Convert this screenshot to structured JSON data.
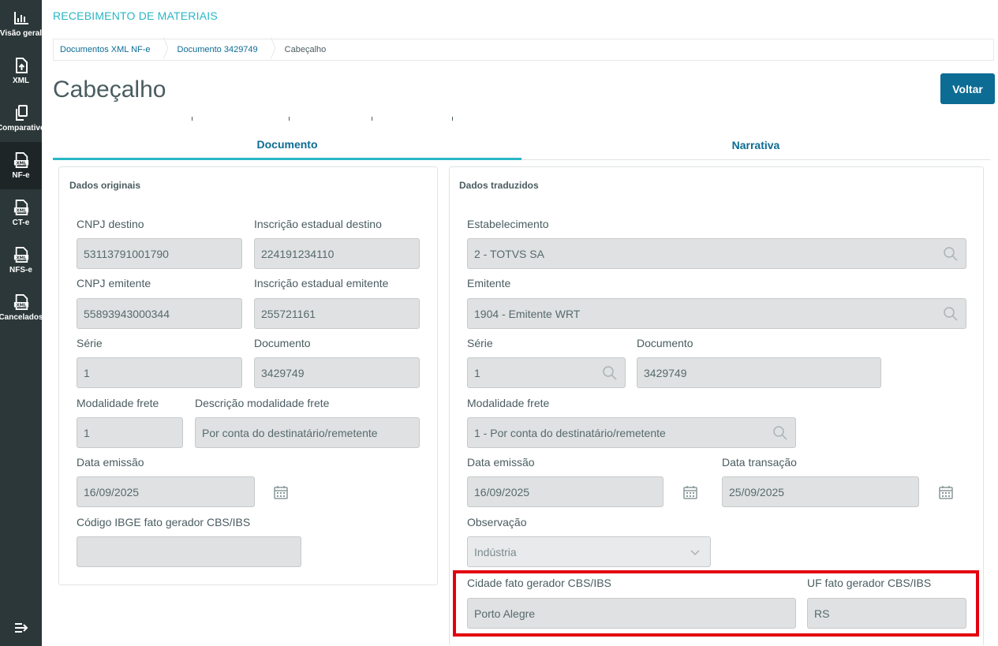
{
  "app": {
    "title": "RECEBIMENTO DE MATERIAIS"
  },
  "sidebar": {
    "items": [
      {
        "label": "Visão geral",
        "icon": "chart-icon"
      },
      {
        "label": "XML",
        "icon": "upload-file-icon"
      },
      {
        "label": "Comparativo",
        "icon": "copy-icon"
      },
      {
        "label": "NF-e",
        "icon": "xml-file-icon",
        "active": true
      },
      {
        "label": "CT-e",
        "icon": "xml-file-icon"
      },
      {
        "label": "NFS-e",
        "icon": "xml-file-icon"
      },
      {
        "label": "Cancelados",
        "icon": "xml-file-icon"
      }
    ],
    "collapse_icon": "collapse-menu-icon"
  },
  "breadcrumb": [
    {
      "label": "Documentos XML NF-e"
    },
    {
      "label": "Documento 3429749"
    },
    {
      "label": "Cabeçalho"
    }
  ],
  "page": {
    "title": "Cabeçalho",
    "back_label": "Voltar"
  },
  "tabs": [
    {
      "label": "Documento",
      "active": true
    },
    {
      "label": "Narrativa",
      "active": false
    }
  ],
  "left_panel": {
    "title": "Dados originais",
    "fields": {
      "cnpj_destino": {
        "label": "CNPJ destino",
        "value": "53113791001790"
      },
      "ie_destino": {
        "label": "Inscrição estadual destino",
        "value": "224191234110"
      },
      "cnpj_emitente": {
        "label": "CNPJ emitente",
        "value": "55893943000344"
      },
      "ie_emitente": {
        "label": "Inscrição estadual emitente",
        "value": "255721161"
      },
      "serie": {
        "label": "Série",
        "value": "1"
      },
      "documento": {
        "label": "Documento",
        "value": "3429749"
      },
      "modalidade_frete": {
        "label": "Modalidade frete",
        "value": "1"
      },
      "desc_modalidade": {
        "label": "Descrição modalidade frete",
        "value": "Por conta do destinatário/remetente"
      },
      "data_emissao": {
        "label": "Data emissão",
        "value": "16/09/2025"
      },
      "codigo_ibge": {
        "label": "Código IBGE fato gerador CBS/IBS",
        "value": ""
      }
    }
  },
  "right_panel": {
    "title": "Dados traduzidos",
    "fields": {
      "estabelecimento": {
        "label": "Estabelecimento",
        "value": "2 - TOTVS SA"
      },
      "emitente": {
        "label": "Emitente",
        "value": "1904 - Emitente WRT"
      },
      "serie": {
        "label": "Série",
        "value": "1"
      },
      "documento": {
        "label": "Documento",
        "value": "3429749"
      },
      "modalidade_frete": {
        "label": "Modalidade frete",
        "value": "1 - Por conta do destinatário/remetente"
      },
      "data_emissao": {
        "label": "Data emissão",
        "value": "16/09/2025"
      },
      "data_transacao": {
        "label": "Data transação",
        "value": "25/09/2025"
      },
      "observacao": {
        "label": "Observação",
        "value": "Indústria"
      },
      "cidade_fato_gerador": {
        "label": "Cidade fato gerador CBS/IBS",
        "value": "Porto Alegre"
      },
      "uf_fato_gerador": {
        "label": "UF fato gerador CBS/IBS",
        "value": "RS"
      }
    }
  },
  "colors": {
    "accent": "#29b6c5",
    "primary": "#0c6c94",
    "highlight": "#e3000f",
    "sidebar": "#2c3739"
  }
}
